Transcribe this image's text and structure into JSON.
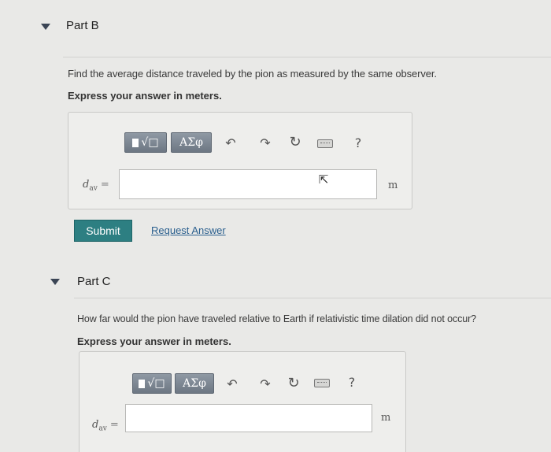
{
  "partB": {
    "title": "Part B",
    "question": "Find the average distance traveled by the pion as measured by the same observer.",
    "instruction": "Express your answer in meters.",
    "toolbar": {
      "sqrt_label": "√□",
      "greek_label": "ΑΣφ",
      "help_label": "?"
    },
    "variable": "d",
    "variable_sub": "av",
    "equals": "=",
    "input_value": "",
    "unit": "m",
    "submit_label": "Submit",
    "request_label": "Request Answer"
  },
  "partC": {
    "title": "Part C",
    "question": "How far would the pion have traveled relative to Earth if relativistic time dilation did not occur?",
    "instruction": "Express your answer in meters.",
    "toolbar": {
      "sqrt_label": "√□",
      "greek_label": "ΑΣφ",
      "help_label": "?"
    },
    "variable": "d",
    "variable_sub": "av",
    "equals": "=",
    "input_value": "",
    "unit": "m"
  },
  "colors": {
    "submit": "#2d7f82",
    "link": "#2a5f8e",
    "toolbar_button": "#7b8590"
  }
}
